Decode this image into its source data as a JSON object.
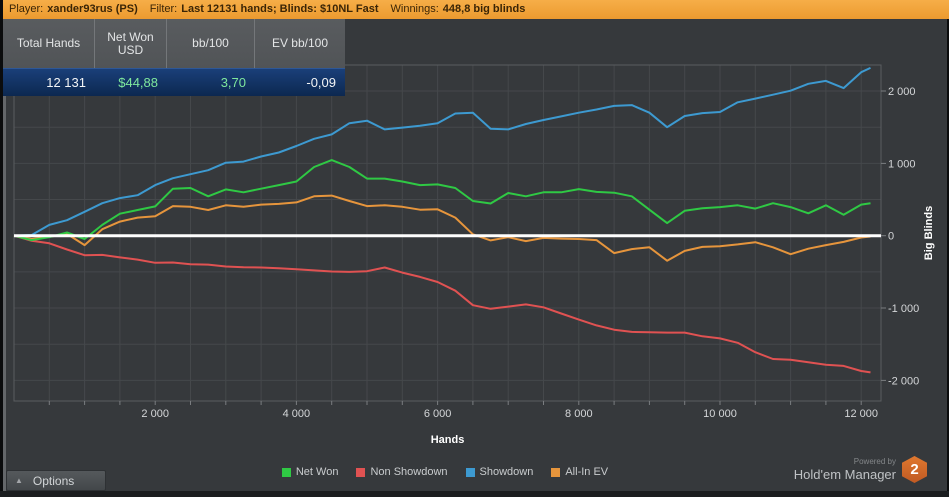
{
  "top_bar": {
    "bg": "#EC9A2F",
    "segments": [
      {
        "label": "Player:",
        "value": "xander93rus (PS)"
      },
      {
        "label": "Filter:",
        "value": "Last 12131 hands; Blinds: $10NL Fast"
      },
      {
        "label": "Winnings:",
        "value": "448,8 big blinds"
      }
    ]
  },
  "stats_table": {
    "columns": [
      "Total Hands",
      "Net Won USD",
      "bb/100",
      "EV bb/100"
    ],
    "row": {
      "total_hands": "12 131",
      "net_won_usd": "$44,88",
      "bb_100": "3,70",
      "ev_bb_100": "-0,09"
    },
    "value_color_positive": "#7FE89E",
    "row_highlight": "#0C2850"
  },
  "chart_data": {
    "type": "line",
    "xlabel": "Hands",
    "ylabel": "Big Blinds",
    "xlim": [
      0,
      12280
    ],
    "ylim": [
      -2285,
      2360
    ],
    "grid_step_x": 500,
    "grid_step_y": 500,
    "grid_color": "#45484B",
    "border_color": "#5A5D60",
    "tick_color": "#7A7D80",
    "tick_label_color": "#D4D6D8",
    "zero_line_color": "#FFFFFF",
    "x_ticks": [
      {
        "v": 2000,
        "label": "2 000"
      },
      {
        "v": 4000,
        "label": "4 000"
      },
      {
        "v": 6000,
        "label": "6 000"
      },
      {
        "v": 8000,
        "label": "8 000"
      },
      {
        "v": 10000,
        "label": "10 000"
      },
      {
        "v": 12000,
        "label": "12 000"
      }
    ],
    "y_ticks": [
      {
        "v": 2000,
        "label": "2 000"
      },
      {
        "v": 1000,
        "label": "1 000"
      },
      {
        "v": 0,
        "label": "0"
      },
      {
        "v": -1000,
        "label": "-1 000"
      },
      {
        "v": -2000,
        "label": "-2 000"
      }
    ],
    "series": [
      {
        "name": "Net Won",
        "color": "#2FC944",
        "points": [
          [
            0,
            0
          ],
          [
            250,
            -60
          ],
          [
            500,
            -20
          ],
          [
            750,
            45
          ],
          [
            1000,
            -45
          ],
          [
            1250,
            150
          ],
          [
            1500,
            305
          ],
          [
            1750,
            355
          ],
          [
            2000,
            405
          ],
          [
            2250,
            650
          ],
          [
            2500,
            660
          ],
          [
            2750,
            545
          ],
          [
            3000,
            640
          ],
          [
            3250,
            600
          ],
          [
            3500,
            650
          ],
          [
            3750,
            700
          ],
          [
            4000,
            750
          ],
          [
            4250,
            950
          ],
          [
            4500,
            1045
          ],
          [
            4750,
            950
          ],
          [
            5000,
            790
          ],
          [
            5250,
            790
          ],
          [
            5500,
            750
          ],
          [
            5750,
            700
          ],
          [
            6000,
            710
          ],
          [
            6250,
            660
          ],
          [
            6500,
            480
          ],
          [
            6750,
            445
          ],
          [
            7000,
            590
          ],
          [
            7250,
            545
          ],
          [
            7500,
            600
          ],
          [
            7750,
            600
          ],
          [
            8000,
            645
          ],
          [
            8250,
            605
          ],
          [
            8500,
            595
          ],
          [
            8750,
            545
          ],
          [
            9000,
            360
          ],
          [
            9250,
            175
          ],
          [
            9500,
            345
          ],
          [
            9750,
            380
          ],
          [
            10000,
            395
          ],
          [
            10250,
            420
          ],
          [
            10500,
            375
          ],
          [
            10750,
            450
          ],
          [
            11000,
            395
          ],
          [
            11250,
            310
          ],
          [
            11500,
            420
          ],
          [
            11750,
            290
          ],
          [
            12000,
            430
          ],
          [
            12131,
            449
          ]
        ]
      },
      {
        "name": "Non Showdown",
        "color": "#E05252",
        "points": [
          [
            0,
            0
          ],
          [
            250,
            -70
          ],
          [
            500,
            -105
          ],
          [
            750,
            -190
          ],
          [
            1000,
            -270
          ],
          [
            1250,
            -265
          ],
          [
            1500,
            -300
          ],
          [
            1750,
            -330
          ],
          [
            2000,
            -375
          ],
          [
            2250,
            -370
          ],
          [
            2500,
            -395
          ],
          [
            2750,
            -400
          ],
          [
            3000,
            -425
          ],
          [
            3250,
            -435
          ],
          [
            3500,
            -440
          ],
          [
            3750,
            -450
          ],
          [
            4000,
            -465
          ],
          [
            4250,
            -480
          ],
          [
            4500,
            -495
          ],
          [
            4750,
            -500
          ],
          [
            5000,
            -490
          ],
          [
            5250,
            -440
          ],
          [
            5500,
            -510
          ],
          [
            5750,
            -570
          ],
          [
            6000,
            -640
          ],
          [
            6250,
            -760
          ],
          [
            6500,
            -960
          ],
          [
            6750,
            -1010
          ],
          [
            7000,
            -980
          ],
          [
            7250,
            -950
          ],
          [
            7500,
            -990
          ],
          [
            7750,
            -1075
          ],
          [
            8000,
            -1160
          ],
          [
            8250,
            -1240
          ],
          [
            8500,
            -1300
          ],
          [
            8750,
            -1330
          ],
          [
            9000,
            -1335
          ],
          [
            9250,
            -1340
          ],
          [
            9500,
            -1340
          ],
          [
            9750,
            -1390
          ],
          [
            10000,
            -1420
          ],
          [
            10250,
            -1480
          ],
          [
            10500,
            -1610
          ],
          [
            10750,
            -1705
          ],
          [
            11000,
            -1715
          ],
          [
            11250,
            -1750
          ],
          [
            11500,
            -1785
          ],
          [
            11750,
            -1800
          ],
          [
            12000,
            -1870
          ],
          [
            12131,
            -1890
          ]
        ]
      },
      {
        "name": "Showdown",
        "color": "#3D9AD1",
        "points": [
          [
            0,
            0
          ],
          [
            250,
            10
          ],
          [
            500,
            150
          ],
          [
            750,
            215
          ],
          [
            1000,
            330
          ],
          [
            1250,
            450
          ],
          [
            1500,
            520
          ],
          [
            1750,
            560
          ],
          [
            2000,
            700
          ],
          [
            2250,
            795
          ],
          [
            2500,
            850
          ],
          [
            2750,
            905
          ],
          [
            3000,
            1010
          ],
          [
            3250,
            1025
          ],
          [
            3500,
            1095
          ],
          [
            3750,
            1150
          ],
          [
            4000,
            1240
          ],
          [
            4250,
            1340
          ],
          [
            4500,
            1400
          ],
          [
            4750,
            1555
          ],
          [
            5000,
            1590
          ],
          [
            5250,
            1470
          ],
          [
            5500,
            1495
          ],
          [
            5750,
            1520
          ],
          [
            6000,
            1555
          ],
          [
            6250,
            1690
          ],
          [
            6500,
            1700
          ],
          [
            6750,
            1480
          ],
          [
            7000,
            1470
          ],
          [
            7250,
            1545
          ],
          [
            7500,
            1600
          ],
          [
            7750,
            1650
          ],
          [
            8000,
            1700
          ],
          [
            8250,
            1745
          ],
          [
            8500,
            1795
          ],
          [
            8750,
            1805
          ],
          [
            9000,
            1700
          ],
          [
            9250,
            1500
          ],
          [
            9500,
            1655
          ],
          [
            9750,
            1695
          ],
          [
            10000,
            1710
          ],
          [
            10250,
            1845
          ],
          [
            10500,
            1895
          ],
          [
            10750,
            1950
          ],
          [
            11000,
            2005
          ],
          [
            11250,
            2100
          ],
          [
            11500,
            2140
          ],
          [
            11750,
            2040
          ],
          [
            12000,
            2260
          ],
          [
            12131,
            2320
          ]
        ]
      },
      {
        "name": "All-In EV",
        "color": "#E6953C",
        "points": [
          [
            0,
            0
          ],
          [
            250,
            -45
          ],
          [
            500,
            -15
          ],
          [
            750,
            25
          ],
          [
            1000,
            -130
          ],
          [
            1250,
            90
          ],
          [
            1500,
            195
          ],
          [
            1750,
            250
          ],
          [
            2000,
            270
          ],
          [
            2250,
            410
          ],
          [
            2500,
            400
          ],
          [
            2750,
            355
          ],
          [
            3000,
            420
          ],
          [
            3250,
            400
          ],
          [
            3500,
            430
          ],
          [
            3750,
            440
          ],
          [
            4000,
            460
          ],
          [
            4250,
            545
          ],
          [
            4500,
            555
          ],
          [
            4750,
            480
          ],
          [
            5000,
            410
          ],
          [
            5250,
            420
          ],
          [
            5500,
            400
          ],
          [
            5750,
            360
          ],
          [
            6000,
            365
          ],
          [
            6250,
            250
          ],
          [
            6500,
            20
          ],
          [
            6750,
            -65
          ],
          [
            7000,
            -20
          ],
          [
            7250,
            -75
          ],
          [
            7500,
            -30
          ],
          [
            7750,
            -40
          ],
          [
            8000,
            -45
          ],
          [
            8250,
            -60
          ],
          [
            8500,
            -240
          ],
          [
            8750,
            -185
          ],
          [
            9000,
            -160
          ],
          [
            9250,
            -345
          ],
          [
            9500,
            -210
          ],
          [
            9750,
            -155
          ],
          [
            10000,
            -145
          ],
          [
            10250,
            -120
          ],
          [
            10500,
            -90
          ],
          [
            10750,
            -160
          ],
          [
            11000,
            -255
          ],
          [
            11250,
            -180
          ],
          [
            11500,
            -130
          ],
          [
            11750,
            -85
          ],
          [
            12000,
            -25
          ],
          [
            12131,
            -11
          ]
        ]
      }
    ]
  },
  "footer": {
    "options_label": "Options",
    "powered_by": "Powered by",
    "brand": "Hold'em Manager",
    "brand_badge": "2"
  }
}
